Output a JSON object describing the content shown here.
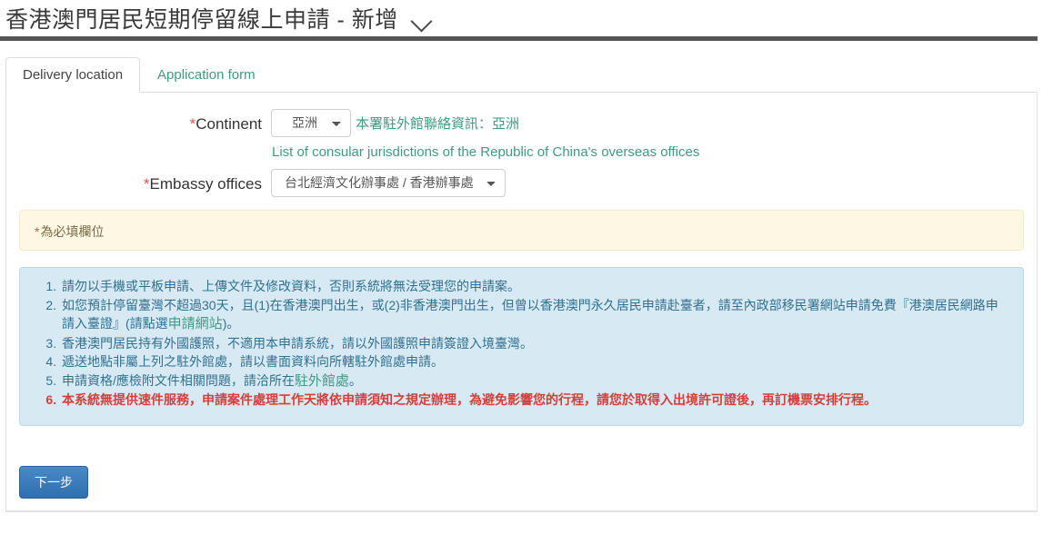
{
  "header": {
    "title": "香港澳門居民短期停留線上申請 - 新增",
    "collapse_icon": "chevron-down-icon"
  },
  "tabs": [
    {
      "label": "Delivery location",
      "active": true
    },
    {
      "label": "Application form",
      "active": false
    }
  ],
  "form": {
    "continent": {
      "label": "Continent",
      "required_mark": "*",
      "selected": "亞洲",
      "options": [
        "亞洲"
      ],
      "hint_text": "本署駐外館聯絡資訊：亞洲",
      "link_text": "List of consular jurisdictions of the Republic of China's overseas offices"
    },
    "embassy": {
      "label": "Embassy offices",
      "required_mark": "*",
      "selected": "台北經濟文化辦事處 / 香港辦事處",
      "options": [
        "台北經濟文化辦事處 / 香港辦事處"
      ]
    }
  },
  "required_alert": {
    "star": "*",
    "text": "為必填欄位"
  },
  "info_box": {
    "items": [
      {
        "text": "請勿以手機或平板申請、上傳文件及修改資料，否則系統將無法受理您的申請案。",
        "style": "normal"
      },
      {
        "text_before_link": "如您預計停留臺灣不超過30天，且(1)在香港澳門出生，或(2)非香港澳門出生，但曾以香港澳門永久居民申請赴臺者，請至內政部移民署網站申請免費『港澳居民網路申請入臺證』(請點選",
        "link": "申請網站",
        "text_after_link": ")。",
        "style": "normal"
      },
      {
        "text": "香港澳門居民持有外國護照，不適用本申請系統，請以外國護照申請簽證入境臺灣。",
        "style": "normal"
      },
      {
        "text": "遞送地點非屬上列之駐外館處，請以書面資料向所轄駐外館處申請。",
        "style": "normal"
      },
      {
        "text_before_link": "申請資格/應檢附文件相關問題，請洽所在",
        "link": "駐外館處",
        "text_after_link": "。",
        "style": "normal"
      },
      {
        "text": "本系統無提供速件服務，申請案件處理工作天將依申請須知之規定辦理，為避免影響您的行程，請您於取得入出境許可證後，再訂機票安排行程。",
        "style": "warn"
      }
    ]
  },
  "footer": {
    "next_label": "下一步"
  },
  "colors": {
    "teal_link": "#3f9a82",
    "required_red": "#d9534f",
    "info_blue_bg": "#d7eaf4",
    "info_blue_text": "#31708f",
    "warn_red": "#d43f3a",
    "alert_yellow_bg": "#fcf8e3",
    "primary_button": "#2f6fad"
  }
}
